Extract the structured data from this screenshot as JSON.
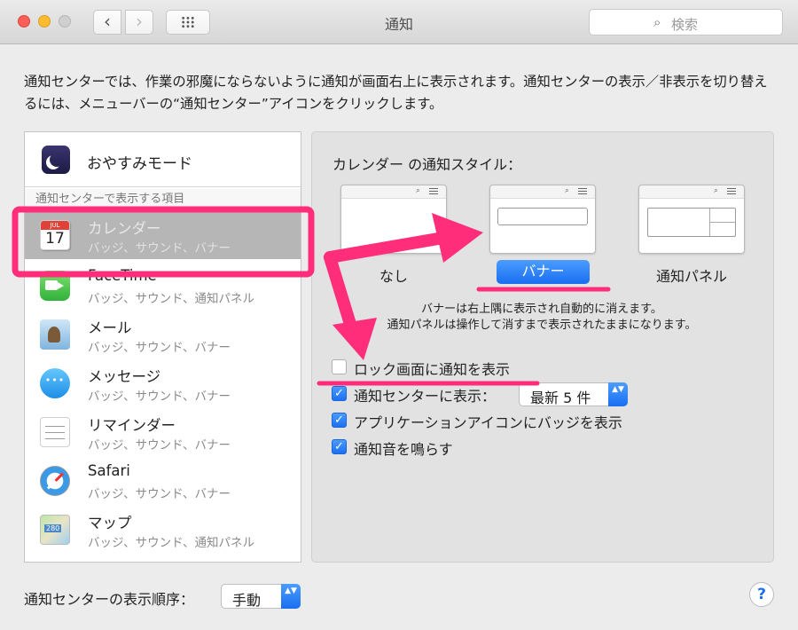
{
  "window": {
    "title": "通知",
    "search_placeholder": "検索",
    "back_glyph": "‹",
    "forward_glyph": "›"
  },
  "description": "通知センターでは、作業の邪魔にならないように通知が画面右上に表示されます。通知センターの表示／非表示を切り替えるには、メニューバーの“通知センター”アイコンをクリックします。",
  "sidebar": {
    "dnd_label": "おやすみモード",
    "section_header": "通知センターで表示する項目",
    "apps": [
      {
        "name": "カレンダー",
        "sub": "バッジ、サウンド、バナー",
        "icon": "calendar-icon",
        "selected": true
      },
      {
        "name": "FaceTime",
        "sub": "バッジ、サウンド、通知パネル",
        "icon": "facetime-icon"
      },
      {
        "name": "メール",
        "sub": "バッジ、サウンド、バナー",
        "icon": "mail-icon"
      },
      {
        "name": "メッセージ",
        "sub": "バッジ、サウンド、バナー",
        "icon": "messages-icon"
      },
      {
        "name": "リマインダー",
        "sub": "バッジ、サウンド、バナー",
        "icon": "reminders-icon"
      },
      {
        "name": "Safari",
        "sub": "バッジ、サウンド、バナー",
        "icon": "safari-icon"
      },
      {
        "name": "マップ",
        "sub": "バッジ、サウンド、通知パネル",
        "icon": "maps-icon"
      }
    ],
    "calendar_icon": {
      "month": "JUL",
      "day": "17"
    }
  },
  "detail": {
    "style_title": "カレンダー の通知スタイル：",
    "styles": [
      {
        "label": "なし"
      },
      {
        "label": "バナー",
        "selected": true
      },
      {
        "label": "通知パネル"
      }
    ],
    "style_desc_1": "バナーは右上隅に表示され自動的に消えます。",
    "style_desc_2": "通知パネルは操作して消すまで表示されたままになります。",
    "options": [
      {
        "label": "ロック画面に通知を表示",
        "checked": false
      },
      {
        "label": "通知センターに表示：",
        "checked": true
      },
      {
        "label": "アプリケーションアイコンにバッジを表示",
        "checked": true
      },
      {
        "label": "通知音を鳴らす",
        "checked": true
      }
    ],
    "recent_count": "最新 5 件"
  },
  "footer": {
    "order_label": "通知センターの表示順序：",
    "order_value": "手動",
    "help_glyph": "?"
  },
  "colors": {
    "accent": "#1a6ef0",
    "annotation": "#ff2d7a",
    "selected_row": "#b6b6b6"
  },
  "icons": {
    "check": "✓",
    "stepper": "▲▼",
    "magnifier": "⌕"
  }
}
